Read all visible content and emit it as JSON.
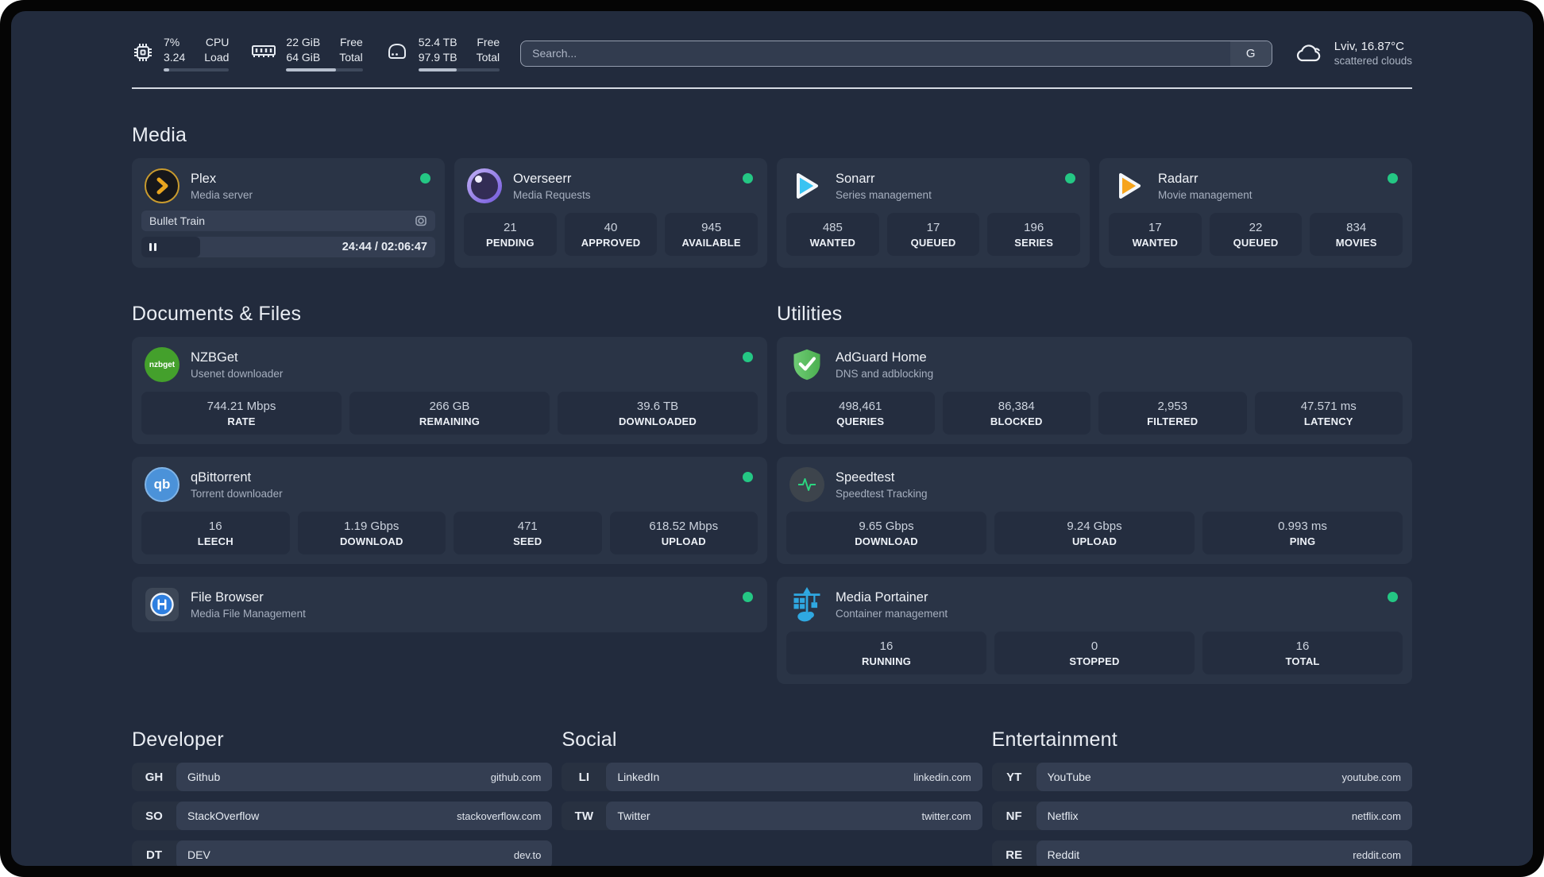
{
  "header": {
    "system_stats": [
      {
        "icon": "cpu-icon",
        "values": [
          "7%",
          "3.24"
        ],
        "labels": [
          "CPU",
          "Load"
        ],
        "progress_pct": 8
      },
      {
        "icon": "ram-icon",
        "values": [
          "22 GiB",
          "64 GiB"
        ],
        "labels": [
          "Free",
          "Total"
        ],
        "progress_pct": 65
      },
      {
        "icon": "disk-icon",
        "values": [
          "52.4 TB",
          "97.9 TB"
        ],
        "labels": [
          "Free",
          "Total"
        ],
        "progress_pct": 47
      }
    ],
    "search": {
      "placeholder": "Search...",
      "engine_button": "G"
    },
    "weather": {
      "location": "Lviv, 16.87°C",
      "condition": "scattered clouds"
    }
  },
  "media": {
    "heading": "Media",
    "plex": {
      "name": "Plex",
      "description": "Media server",
      "online": true,
      "now_playing": {
        "title": "Bullet Train",
        "time_display": "24:44 / 02:06:47",
        "progress_pct": 20
      }
    },
    "apps": [
      {
        "name": "Overseerr",
        "description": "Media Requests",
        "online": true,
        "stats": [
          {
            "value": "21",
            "label": "PENDING"
          },
          {
            "value": "40",
            "label": "APPROVED"
          },
          {
            "value": "945",
            "label": "AVAILABLE"
          }
        ]
      },
      {
        "name": "Sonarr",
        "description": "Series management",
        "online": true,
        "stats": [
          {
            "value": "485",
            "label": "WANTED"
          },
          {
            "value": "17",
            "label": "QUEUED"
          },
          {
            "value": "196",
            "label": "SERIES"
          }
        ]
      },
      {
        "name": "Radarr",
        "description": "Movie management",
        "online": true,
        "stats": [
          {
            "value": "17",
            "label": "WANTED"
          },
          {
            "value": "22",
            "label": "QUEUED"
          },
          {
            "value": "834",
            "label": "MOVIES"
          }
        ]
      }
    ]
  },
  "documents": {
    "heading": "Documents & Files",
    "apps": [
      {
        "name": "NZBGet",
        "description": "Usenet downloader",
        "online": true,
        "stats": [
          {
            "value": "744.21 Mbps",
            "label": "RATE"
          },
          {
            "value": "266 GB",
            "label": "REMAINING"
          },
          {
            "value": "39.6 TB",
            "label": "DOWNLOADED"
          }
        ]
      },
      {
        "name": "qBittorrent",
        "description": "Torrent downloader",
        "online": true,
        "stats": [
          {
            "value": "16",
            "label": "LEECH"
          },
          {
            "value": "1.19 Gbps",
            "label": "DOWNLOAD"
          },
          {
            "value": "471",
            "label": "SEED"
          },
          {
            "value": "618.52 Mbps",
            "label": "UPLOAD"
          }
        ]
      },
      {
        "name": "File Browser",
        "description": "Media File Management",
        "online": true,
        "stats": []
      }
    ]
  },
  "utilities": {
    "heading": "Utilities",
    "apps": [
      {
        "name": "AdGuard Home",
        "description": "DNS and adblocking",
        "online": false,
        "stats": [
          {
            "value": "498,461",
            "label": "QUERIES"
          },
          {
            "value": "86,384",
            "label": "BLOCKED"
          },
          {
            "value": "2,953",
            "label": "FILTERED"
          },
          {
            "value": "47.571 ms",
            "label": "LATENCY"
          }
        ]
      },
      {
        "name": "Speedtest",
        "description": "Speedtest Tracking",
        "online": false,
        "stats": [
          {
            "value": "9.65 Gbps",
            "label": "DOWNLOAD"
          },
          {
            "value": "9.24 Gbps",
            "label": "UPLOAD"
          },
          {
            "value": "0.993 ms",
            "label": "PING"
          }
        ]
      },
      {
        "name": "Media Portainer",
        "description": "Container management",
        "online": true,
        "stats": [
          {
            "value": "16",
            "label": "RUNNING"
          },
          {
            "value": "0",
            "label": "STOPPED"
          },
          {
            "value": "16",
            "label": "TOTAL"
          }
        ]
      }
    ]
  },
  "bookmarks": [
    {
      "heading": "Developer",
      "links": [
        {
          "tag": "GH",
          "name": "Github",
          "url": "github.com"
        },
        {
          "tag": "SO",
          "name": "StackOverflow",
          "url": "stackoverflow.com"
        },
        {
          "tag": "DT",
          "name": "DEV",
          "url": "dev.to"
        }
      ]
    },
    {
      "heading": "Social",
      "links": [
        {
          "tag": "LI",
          "name": "LinkedIn",
          "url": "linkedin.com"
        },
        {
          "tag": "TW",
          "name": "Twitter",
          "url": "twitter.com"
        }
      ]
    },
    {
      "heading": "Entertainment",
      "links": [
        {
          "tag": "YT",
          "name": "YouTube",
          "url": "youtube.com"
        },
        {
          "tag": "NF",
          "name": "Netflix",
          "url": "netflix.com"
        },
        {
          "tag": "RE",
          "name": "Reddit",
          "url": "reddit.com"
        }
      ]
    }
  ],
  "colors": {
    "page_bg": "#222b3d",
    "card_bg": "#2a3446",
    "stat_bg": "#242d3f",
    "online_dot": "#24c784",
    "plex_gold": "#e9a51f",
    "sonarr_blue": "#39c3f2",
    "radarr_orange": "#f6a41c",
    "nzbget_green": "#44a02c",
    "qbittorrent_blue": "#4b92d9",
    "adguard_green": "#5ec46a",
    "speedtest_green": "#2bd57f",
    "portainer_blue": "#2fa8e1"
  }
}
